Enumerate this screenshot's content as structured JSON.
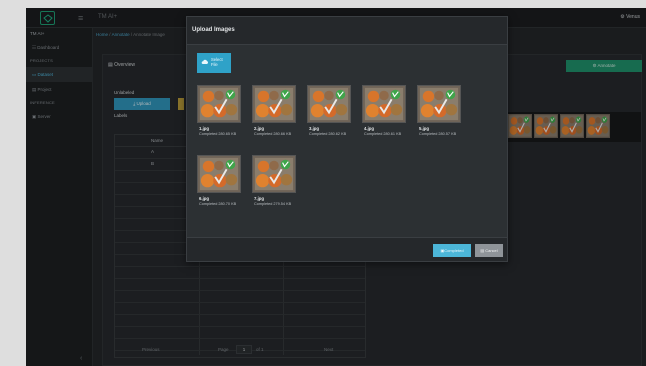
{
  "topbar": {
    "brand": "TM AI+",
    "user": "Venus"
  },
  "sidebar": {
    "head": "TM AI+",
    "items": [
      {
        "label": "Dashboard",
        "section": ""
      },
      {
        "label": "Dataset",
        "section": "PROJECTS"
      },
      {
        "label": "Project",
        "section": ""
      },
      {
        "label": "Server",
        "section": "INFERENCE"
      }
    ],
    "section_projects": "PROJECTS",
    "section_inference": "INFERENCE",
    "collapse": "‹"
  },
  "breadcrumb": {
    "home": "Home",
    "sep": "/",
    "mid": "Annotate",
    "current": "Annotate Image"
  },
  "overview": {
    "title": "Overview",
    "unlabeled": "Unlabeled",
    "upload": "Upload",
    "labels": "Labels"
  },
  "annotate_button": "Annotate",
  "table": {
    "header": "Name",
    "rows": [
      "A",
      "B",
      "",
      "",
      "",
      "",
      "",
      "",
      "",
      "",
      "",
      "",
      "",
      "",
      "",
      "",
      ""
    ]
  },
  "pager": {
    "prev": "Previous",
    "page_label": "Page",
    "page": "1",
    "of": "of 1",
    "next": "Next"
  },
  "modal": {
    "title": "Upload Images",
    "select_label_1": "Select",
    "select_label_2": "File",
    "images": [
      {
        "name": "1.jpg",
        "status": "Completed 280.65 KB"
      },
      {
        "name": "2.jpg",
        "status": "Completed 280.66 KB"
      },
      {
        "name": "3.jpg",
        "status": "Completed 280.62 KB"
      },
      {
        "name": "4.jpg",
        "status": "Completed 280.61 KB"
      },
      {
        "name": "5.jpg",
        "status": "Completed 280.57 KB"
      },
      {
        "name": "6.jpg",
        "status": "Completed 280.70 KB"
      },
      {
        "name": "7.jpg",
        "status": "Completed 279.54 KB"
      }
    ],
    "complete": "Completed",
    "cancel": "Cancel"
  },
  "colors": {
    "accent": "#2fa2c8",
    "annotate": "#1f8f6a",
    "background": "#232628"
  }
}
